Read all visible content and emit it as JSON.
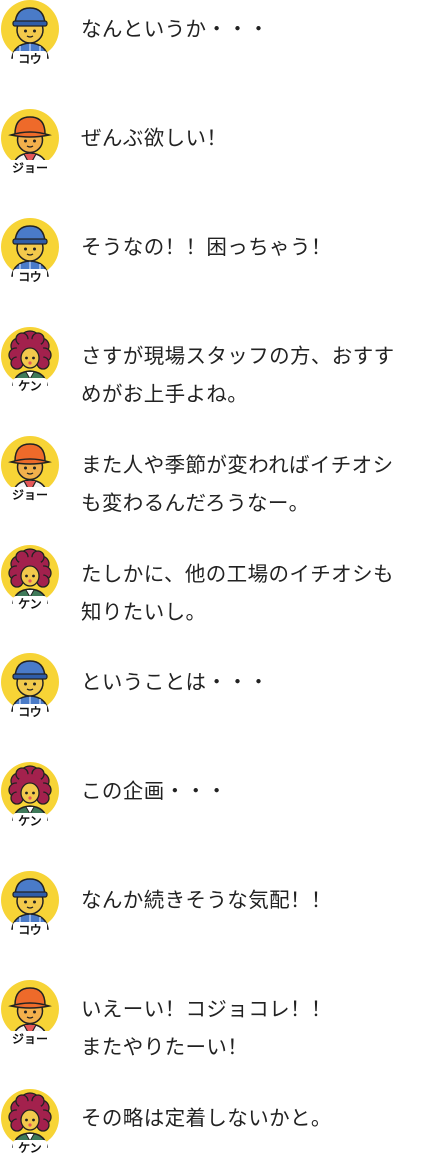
{
  "colors": {
    "avatar_bg": "#F7D436",
    "text": "#222222",
    "name_badge_bg": "#FFFFFF",
    "kou_hat": "#4A7BC8",
    "jo_hat": "#EE6A2A",
    "ken_hair": "#A3214D"
  },
  "messages": [
    {
      "speaker": "kou",
      "name": "コウ",
      "icon": "kou-avatar-icon",
      "text": "なんというか・・・"
    },
    {
      "speaker": "jo",
      "name": "ジョー",
      "icon": "jo-avatar-icon",
      "text": "ぜんぶ欲しい！"
    },
    {
      "speaker": "kou",
      "name": "コウ",
      "icon": "kou-avatar-icon",
      "text": "そうなの！！困っちゃう！"
    },
    {
      "speaker": "ken",
      "name": "ケン",
      "icon": "ken-avatar-icon",
      "text": "さすが現場スタッフの方、おすす\nめがお上手よね。"
    },
    {
      "speaker": "jo",
      "name": "ジョー",
      "icon": "jo-avatar-icon",
      "text": "また人や季節が変わればイチオシ\nも変わるんだろうなー。"
    },
    {
      "speaker": "ken",
      "name": "ケン",
      "icon": "ken-avatar-icon",
      "text": "たしかに、他の工場のイチオシも\n知りたいし。"
    },
    {
      "speaker": "kou",
      "name": "コウ",
      "icon": "kou-avatar-icon",
      "text": "ということは・・・"
    },
    {
      "speaker": "ken",
      "name": "ケン",
      "icon": "ken-avatar-icon",
      "text": "この企画・・・"
    },
    {
      "speaker": "kou",
      "name": "コウ",
      "icon": "kou-avatar-icon",
      "text": "なんか続きそうな気配！！"
    },
    {
      "speaker": "jo",
      "name": "ジョー",
      "icon": "jo-avatar-icon",
      "text": "いえーい！コジョコレ！！\nまたやりたーい！"
    },
    {
      "speaker": "ken",
      "name": "ケン",
      "icon": "ken-avatar-icon",
      "text": "その略は定着しないかと。"
    }
  ]
}
